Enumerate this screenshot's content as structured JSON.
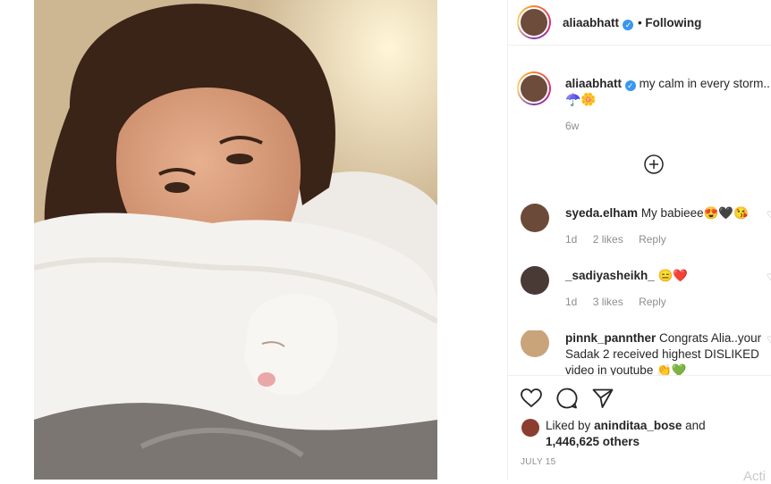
{
  "post": {
    "username": "aliaabhatt",
    "follow_status": "Following",
    "caption_text": "my calm in every storm..",
    "caption_emoji": "☂️🌼",
    "caption_time": "6w",
    "load_more_icon": "plus-circle-icon"
  },
  "comments": [
    {
      "username": "syeda.elham",
      "text": "My babieee😍🖤😘",
      "time": "1d",
      "likes": "2 likes",
      "reply": "Reply",
      "avatar_color": "#6b4a3a"
    },
    {
      "username": "_sadiyasheikh_",
      "text": "😑❤️",
      "time": "1d",
      "likes": "3 likes",
      "reply": "Reply",
      "avatar_color": "#4a3a36"
    },
    {
      "username": "pinnk_pannther",
      "text": "Congrats Alia..your Sadak 2 received highest DISLIKED video in youtube 👏💚",
      "avatar_color": "#c9a37a"
    }
  ],
  "actions": {
    "like_icon": "heart-icon",
    "comment_icon": "comment-icon",
    "share_icon": "share-icon"
  },
  "likes": {
    "prefix": "Liked by",
    "user": "aninditaa_bose",
    "and": "and",
    "count": "1,446,625 others"
  },
  "date": "JULY 15",
  "watermark": "Acti"
}
